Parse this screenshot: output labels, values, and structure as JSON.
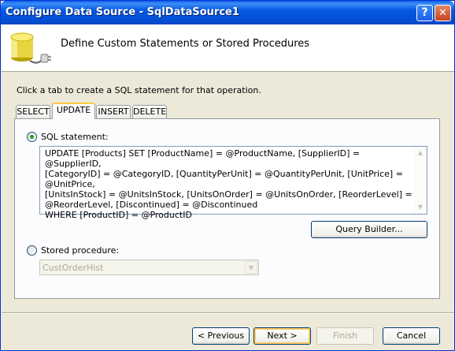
{
  "window": {
    "title": "Configure Data Source - SqlDataSource1",
    "help_label": "?",
    "close_label": "✕"
  },
  "header": {
    "title": "Define Custom Statements or Stored Procedures",
    "icon": "database-connector-icon"
  },
  "instruction": "Click a tab to create a SQL statement for that operation.",
  "tabs": [
    {
      "label": "SELECT",
      "active": false
    },
    {
      "label": "UPDATE",
      "active": true
    },
    {
      "label": "INSERT",
      "active": false
    },
    {
      "label": "DELETE",
      "active": false
    }
  ],
  "sql_statement": {
    "label": "SQL statement:",
    "selected": true,
    "value": "UPDATE [Products] SET [ProductName] = @ProductName, [SupplierID] = @SupplierID,\n[CategoryID] = @CategoryID, [QuantityPerUnit] = @QuantityPerUnit, [UnitPrice] = @UnitPrice,\n[UnitsInStock] = @UnitsInStock, [UnitsOnOrder] = @UnitsOnOrder, [ReorderLevel] =\n@ReorderLevel, [Discontinued] = @Discontinued\nWHERE [ProductID] = @ProductID"
  },
  "query_builder_label": "Query Builder...",
  "stored_procedure": {
    "label": "Stored procedure:",
    "selected": false,
    "value": "CustOrderHist",
    "enabled": false
  },
  "footer": {
    "previous_label": "< Previous",
    "next_label": "Next >",
    "finish_label": "Finish",
    "cancel_label": "Cancel"
  }
}
